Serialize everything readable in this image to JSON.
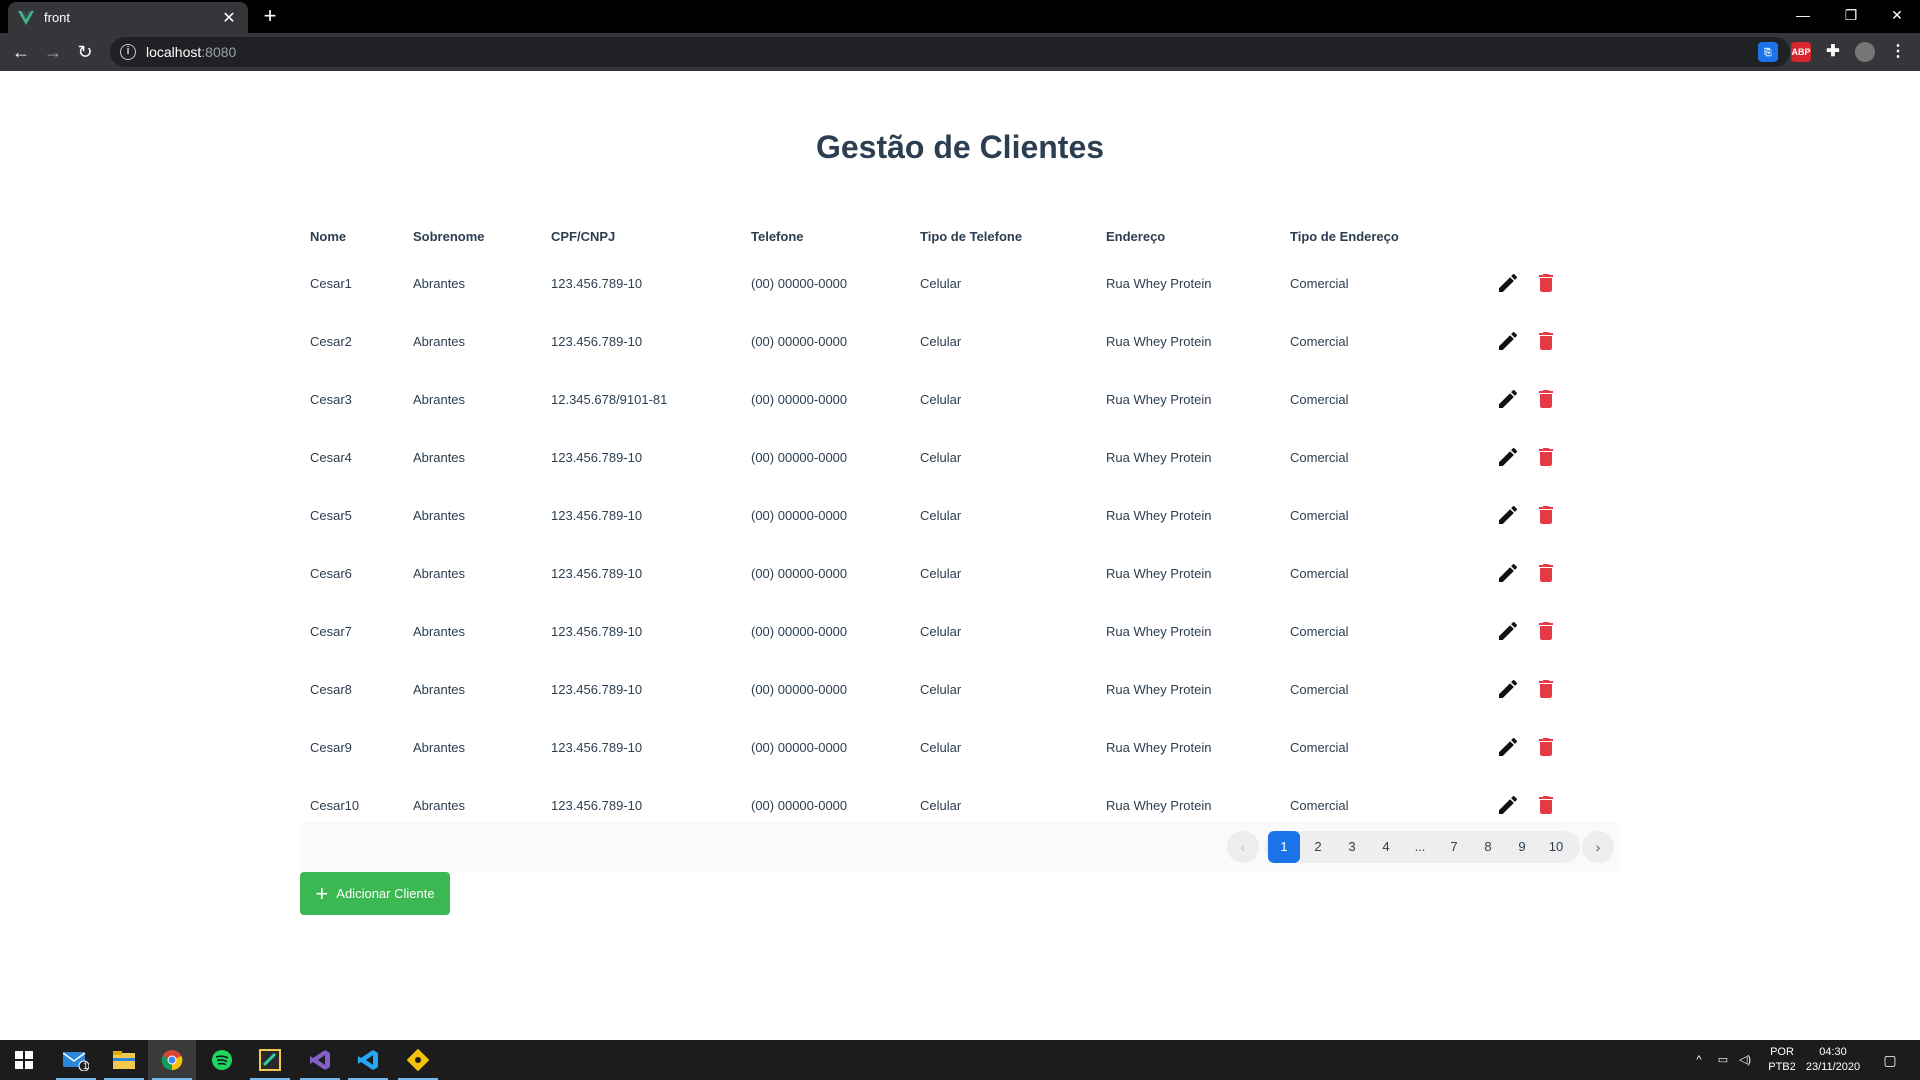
{
  "browser": {
    "tab_title": "front",
    "url_host": "localhost",
    "url_port": ":8080",
    "ext_abp": "ABP"
  },
  "page": {
    "title": "Gestão de Clientes"
  },
  "table": {
    "headers": [
      "Nome",
      "Sobrenome",
      "CPF/CNPJ",
      "Telefone",
      "Tipo de Telefone",
      "Endereço",
      "Tipo de Endereço"
    ],
    "rows": [
      [
        "Cesar1",
        "Abrantes",
        "123.456.789-10",
        "(00) 00000-0000",
        "Celular",
        "Rua Whey Protein",
        "Comercial"
      ],
      [
        "Cesar2",
        "Abrantes",
        "123.456.789-10",
        "(00) 00000-0000",
        "Celular",
        "Rua Whey Protein",
        "Comercial"
      ],
      [
        "Cesar3",
        "Abrantes",
        "12.345.678/9101-81",
        "(00) 00000-0000",
        "Celular",
        "Rua Whey Protein",
        "Comercial"
      ],
      [
        "Cesar4",
        "Abrantes",
        "123.456.789-10",
        "(00) 00000-0000",
        "Celular",
        "Rua Whey Protein",
        "Comercial"
      ],
      [
        "Cesar5",
        "Abrantes",
        "123.456.789-10",
        "(00) 00000-0000",
        "Celular",
        "Rua Whey Protein",
        "Comercial"
      ],
      [
        "Cesar6",
        "Abrantes",
        "123.456.789-10",
        "(00) 00000-0000",
        "Celular",
        "Rua Whey Protein",
        "Comercial"
      ],
      [
        "Cesar7",
        "Abrantes",
        "123.456.789-10",
        "(00) 00000-0000",
        "Celular",
        "Rua Whey Protein",
        "Comercial"
      ],
      [
        "Cesar8",
        "Abrantes",
        "123.456.789-10",
        "(00) 00000-0000",
        "Celular",
        "Rua Whey Protein",
        "Comercial"
      ],
      [
        "Cesar9",
        "Abrantes",
        "123.456.789-10",
        "(00) 00000-0000",
        "Celular",
        "Rua Whey Protein",
        "Comercial"
      ],
      [
        "Cesar10",
        "Abrantes",
        "123.456.789-10",
        "(00) 00000-0000",
        "Celular",
        "Rua Whey Protein",
        "Comercial"
      ]
    ],
    "edit_icon": "pencil-icon",
    "delete_icon": "trash-icon",
    "delete_color": "#e53946"
  },
  "pagination": {
    "prev_icon": "chevron-left-icon",
    "next_icon": "chevron-right-icon",
    "pages": [
      "1",
      "2",
      "3",
      "4",
      "...",
      "7",
      "8",
      "9",
      "10"
    ],
    "current": "1",
    "active_color": "#1a73e8"
  },
  "actions": {
    "add_label": "Adicionar Cliente",
    "add_color": "#3cb853"
  },
  "taskbar": {
    "mail_badge": "1",
    "lang_line1": "POR",
    "lang_line2": "PTB2",
    "time": "04:30",
    "date": "23/11/2020"
  }
}
